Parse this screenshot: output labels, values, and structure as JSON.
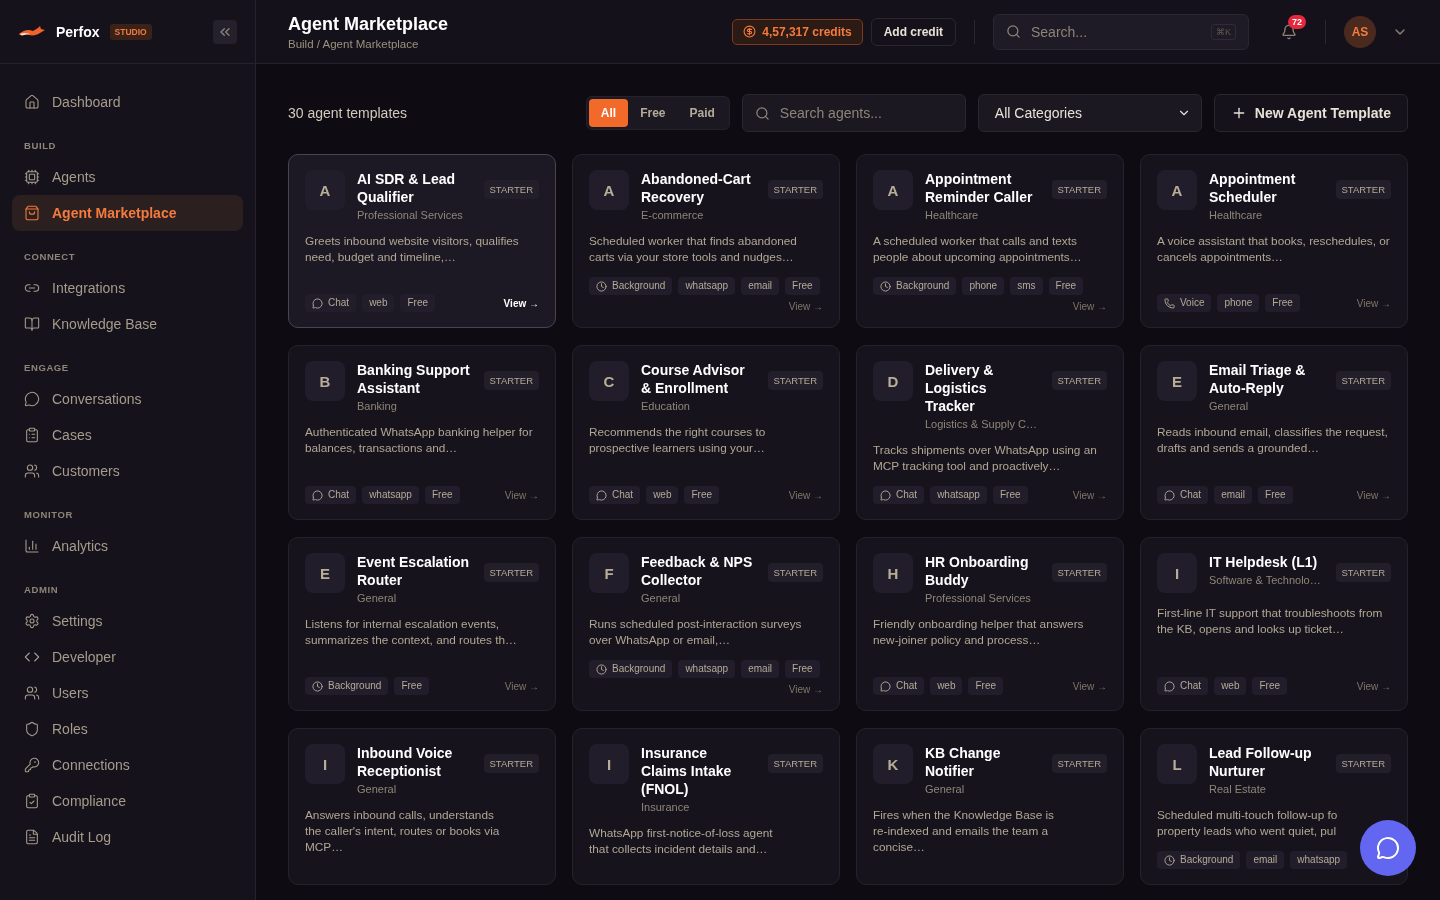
{
  "brand": {
    "name": "Perfox",
    "badge": "STUDIO"
  },
  "sidebar": {
    "sections": [
      {
        "items": [
          {
            "label": "Dashboard",
            "selected": false
          }
        ]
      },
      {
        "label": "BUILD",
        "items": [
          {
            "label": "Agents",
            "selected": false
          },
          {
            "label": "Agent Marketplace",
            "selected": true
          }
        ]
      },
      {
        "label": "CONNECT",
        "items": [
          {
            "label": "Integrations",
            "selected": false
          },
          {
            "label": "Knowledge Base",
            "selected": false
          }
        ]
      },
      {
        "label": "ENGAGE",
        "items": [
          {
            "label": "Conversations",
            "selected": false
          },
          {
            "label": "Cases",
            "selected": false
          },
          {
            "label": "Customers",
            "selected": false
          }
        ]
      },
      {
        "label": "MONITOR",
        "items": [
          {
            "label": "Analytics",
            "selected": false
          }
        ]
      },
      {
        "label": "ADMIN",
        "items": [
          {
            "label": "Settings",
            "selected": false
          },
          {
            "label": "Developer",
            "selected": false
          },
          {
            "label": "Users",
            "selected": false
          },
          {
            "label": "Roles",
            "selected": false
          },
          {
            "label": "Connections",
            "selected": false
          },
          {
            "label": "Compliance",
            "selected": false
          },
          {
            "label": "Audit Log",
            "selected": false
          }
        ]
      }
    ]
  },
  "header": {
    "title": "Agent Marketplace",
    "breadcrumb": "Build / Agent Marketplace",
    "credits": "4,57,317 credits",
    "add_credit": "Add credit",
    "search_placeholder": "Search...",
    "shortcut": "⌘K",
    "notifications": "72",
    "avatar": "AS"
  },
  "toolbar": {
    "count": "30 agent templates",
    "filters": [
      {
        "label": "All",
        "selected": true
      },
      {
        "label": "Free",
        "selected": false
      },
      {
        "label": "Paid",
        "selected": false
      }
    ],
    "search_placeholder": "Search agents...",
    "category": "All Categories",
    "new_button": "New Agent Template"
  },
  "cards": [
    {
      "letter": "A",
      "title": "AI SDR & Lead Qualifier",
      "category": "Professional Services",
      "badge": "STARTER",
      "description": "Greets inbound website visitors, qualifies need, budget and timeline,…",
      "tags": [
        {
          "kind": "chat",
          "label": "Chat"
        },
        {
          "kind": "plain",
          "label": "web"
        },
        {
          "kind": "plain",
          "label": "Free"
        }
      ],
      "view": "View →",
      "hovered": true
    },
    {
      "letter": "A",
      "title": "Abandoned-Cart Recovery",
      "category": "E-commerce",
      "badge": "STARTER",
      "description": "Scheduled worker that finds abandoned carts via your store tools and nudges…",
      "tags": [
        {
          "kind": "background",
          "label": "Background"
        },
        {
          "kind": "plain",
          "label": "whatsapp"
        },
        {
          "kind": "plain",
          "label": "email"
        },
        {
          "kind": "plain",
          "label": "Free"
        }
      ],
      "view": "View →",
      "hovered": false
    },
    {
      "letter": "A",
      "title": "Appointment Reminder Caller",
      "category": "Healthcare",
      "badge": "STARTER",
      "description": "A scheduled worker that calls and texts people about upcoming appointments…",
      "tags": [
        {
          "kind": "background",
          "label": "Background"
        },
        {
          "kind": "plain",
          "label": "phone"
        },
        {
          "kind": "plain",
          "label": "sms"
        },
        {
          "kind": "plain",
          "label": "Free"
        }
      ],
      "view": "View →",
      "hovered": false
    },
    {
      "letter": "A",
      "title": "Appointment Scheduler",
      "category": "Healthcare",
      "badge": "STARTER",
      "description": "A voice assistant that books, reschedules, or cancels appointments…",
      "tags": [
        {
          "kind": "voice",
          "label": "Voice"
        },
        {
          "kind": "plain",
          "label": "phone"
        },
        {
          "kind": "plain",
          "label": "Free"
        }
      ],
      "view": "View →",
      "hovered": false
    },
    {
      "letter": "B",
      "title": "Banking Support Assistant",
      "category": "Banking",
      "badge": "STARTER",
      "description": "Authenticated WhatsApp banking helper for balances, transactions and…",
      "tags": [
        {
          "kind": "chat",
          "label": "Chat"
        },
        {
          "kind": "plain",
          "label": "whatsapp"
        },
        {
          "kind": "plain",
          "label": "Free"
        }
      ],
      "view": "View →",
      "hovered": false
    },
    {
      "letter": "C",
      "title": "Course Advisor & Enrollment",
      "category": "Education",
      "badge": "STARTER",
      "description": "Recommends the right courses to prospective learners using your…",
      "tags": [
        {
          "kind": "chat",
          "label": "Chat"
        },
        {
          "kind": "plain",
          "label": "web"
        },
        {
          "kind": "plain",
          "label": "Free"
        }
      ],
      "view": "View →",
      "hovered": false
    },
    {
      "letter": "D",
      "title": "Delivery & Logistics Tracker",
      "category": "Logistics & Supply C…",
      "badge": "STARTER",
      "description": "Tracks shipments over WhatsApp using an MCP tracking tool and proactively…",
      "tags": [
        {
          "kind": "chat",
          "label": "Chat"
        },
        {
          "kind": "plain",
          "label": "whatsapp"
        },
        {
          "kind": "plain",
          "label": "Free"
        }
      ],
      "view": "View →",
      "hovered": false
    },
    {
      "letter": "E",
      "title": "Email Triage & Auto-Reply",
      "category": "General",
      "badge": "STARTER",
      "description": "Reads inbound email, classifies the request, drafts and sends a grounded…",
      "tags": [
        {
          "kind": "chat",
          "label": "Chat"
        },
        {
          "kind": "plain",
          "label": "email"
        },
        {
          "kind": "plain",
          "label": "Free"
        }
      ],
      "view": "View →",
      "hovered": false
    },
    {
      "letter": "E",
      "title": "Event Escalation Router",
      "category": "General",
      "badge": "STARTER",
      "description": "Listens for internal escalation events, summarizes the context, and routes th…",
      "tags": [
        {
          "kind": "background",
          "label": "Background"
        },
        {
          "kind": "plain",
          "label": "Free"
        }
      ],
      "view": "View →",
      "hovered": false
    },
    {
      "letter": "F",
      "title": "Feedback & NPS Collector",
      "category": "General",
      "badge": "STARTER",
      "description": "Runs scheduled post-interaction surveys over WhatsApp or email,…",
      "tags": [
        {
          "kind": "background",
          "label": "Background"
        },
        {
          "kind": "plain",
          "label": "whatsapp"
        },
        {
          "kind": "plain",
          "label": "email"
        },
        {
          "kind": "plain",
          "label": "Free"
        }
      ],
      "view": "View →",
      "hovered": false
    },
    {
      "letter": "H",
      "title": "HR Onboarding Buddy",
      "category": "Professional Services",
      "badge": "STARTER",
      "description": "Friendly onboarding helper that answers new-joiner policy and process…",
      "tags": [
        {
          "kind": "chat",
          "label": "Chat"
        },
        {
          "kind": "plain",
          "label": "web"
        },
        {
          "kind": "plain",
          "label": "Free"
        }
      ],
      "view": "View →",
      "hovered": false
    },
    {
      "letter": "I",
      "title": "IT Helpdesk (L1)",
      "category": "Software & Technolo…",
      "badge": "STARTER",
      "description": "First-line IT support that troubleshoots from the KB, opens and looks up ticket…",
      "tags": [
        {
          "kind": "chat",
          "label": "Chat"
        },
        {
          "kind": "plain",
          "label": "web"
        },
        {
          "kind": "plain",
          "label": "Free"
        }
      ],
      "view": "View →",
      "hovered": false
    },
    {
      "letter": "I",
      "title": "Inbound Voice Receptionist",
      "category": "General",
      "badge": "STARTER",
      "description": "Answers inbound calls, understands the caller's intent, routes or books via MCP…",
      "hovered": false
    },
    {
      "letter": "I",
      "title": "Insurance Claims Intake (FNOL)",
      "category": "Insurance",
      "badge": "STARTER",
      "description": "WhatsApp first-notice-of-loss agent that collects incident details and…",
      "hovered": false
    },
    {
      "letter": "K",
      "title": "KB Change Notifier",
      "category": "General",
      "badge": "STARTER",
      "description": "Fires when the Knowledge Base is re-indexed and emails the team a concise…",
      "hovered": false
    },
    {
      "letter": "L",
      "title": "Lead Follow-up Nurturer",
      "category": "Real Estate",
      "badge": "STARTER",
      "description": "Scheduled multi-touch follow-up fo property leads who went quiet, pul",
      "tags": [
        {
          "kind": "background",
          "label": "Background"
        },
        {
          "kind": "plain",
          "label": "email"
        },
        {
          "kind": "plain",
          "label": "whatsapp"
        }
      ],
      "hovered": false
    }
  ]
}
